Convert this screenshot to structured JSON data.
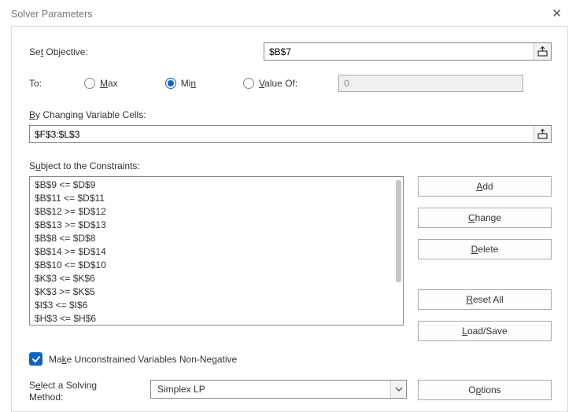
{
  "title": "Solver Parameters",
  "labels": {
    "set_objective": "Set Objective:",
    "to": "To:",
    "max": "Max",
    "min": "Min",
    "value_of": "Value Of:",
    "by_changing": "By Changing Variable Cells:",
    "subject_to": "Subject to the Constraints:",
    "make_unconstrained": "Make Unconstrained Variables Non-Negative",
    "select_method": "Select a Solving Method:"
  },
  "values": {
    "objective": "$B$7",
    "value_of_value": "0",
    "changing_cells": "$F$3:$L$3",
    "solving_method": "Simplex LP",
    "to_selected": "min",
    "make_unconstrained_checked": true
  },
  "constraints": [
    "$B$9 <= $D$9",
    "$B$11 <= $D$11",
    "$B$12 >= $D$12",
    "$B$13 >= $D$13",
    "$B$8 <= $D$8",
    "$B$14 >= $D$14",
    "$B$10 <= $D$10",
    "$K$3 <= $K$6",
    "$K$3 >= $K$5",
    "$I$3 <= $I$6",
    "$H$3 <= $H$6"
  ],
  "buttons": {
    "add": "Add",
    "change": "Change",
    "delete": "Delete",
    "reset_all": "Reset All",
    "load_save": "Load/Save",
    "options": "Options"
  }
}
